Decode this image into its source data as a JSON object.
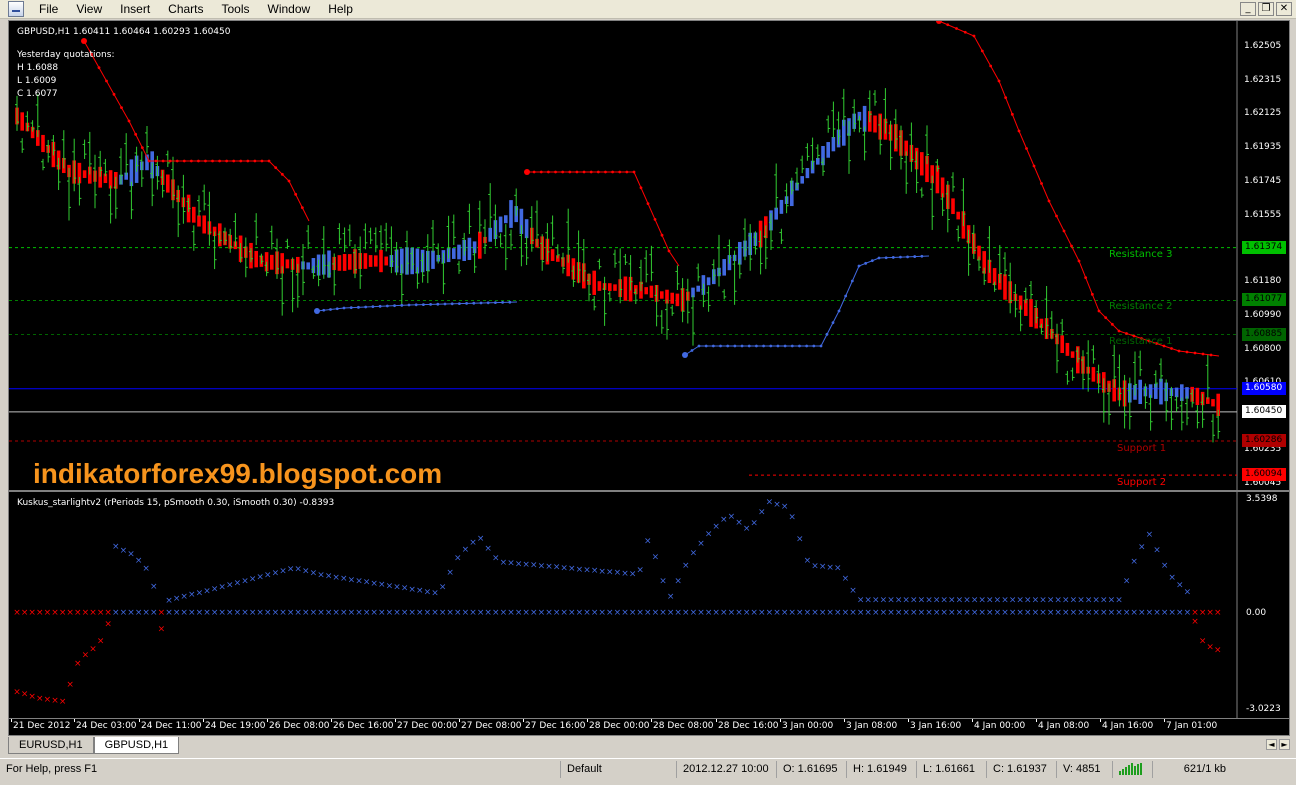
{
  "menu": [
    "File",
    "View",
    "Insert",
    "Charts",
    "Tools",
    "Window",
    "Help"
  ],
  "window_controls": [
    "_",
    "❐",
    "✕"
  ],
  "chart": {
    "title": "GBPUSD,H1  1.60411 1.60464 1.60293 1.60450",
    "quotes": {
      "heading": "Yesterday quotations:",
      "high": "H 1.6088",
      "low": "L 1.6009",
      "close": "C 1.6077"
    },
    "price_scale": [
      "1.62505",
      "1.62315",
      "1.62125",
      "1.61935",
      "1.61745",
      "1.61555",
      "1.61180",
      "1.60990",
      "1.60800",
      "1.60610",
      "1.60420",
      "1.60235",
      "1.60045"
    ],
    "price_scale_range": [
      1.60045,
      1.62505
    ],
    "highlighted_prices": [
      {
        "label": "1.61374",
        "bg": "#00c000",
        "fg": "#000000"
      },
      {
        "label": "1.61077",
        "bg": "#008000",
        "fg": "#000000"
      },
      {
        "label": "1.60885",
        "bg": "#006400",
        "fg": "#000000"
      },
      {
        "label": "1.60580",
        "bg": "#0000ff",
        "fg": "#ffffff"
      },
      {
        "label": "1.60450",
        "bg": "#ffffff",
        "fg": "#000000"
      },
      {
        "label": "1.60286",
        "bg": "#b00000",
        "fg": "#000000"
      },
      {
        "label": "1.60094",
        "bg": "#ff0000",
        "fg": "#000000"
      }
    ],
    "levels": [
      {
        "name": "Resistance 3",
        "price": 1.61374,
        "color": "#00c000"
      },
      {
        "name": "Resistance 2",
        "price": 1.61077,
        "color": "#008000"
      },
      {
        "name": "Resistance 1",
        "price": 1.60885,
        "color": "#006400"
      },
      {
        "name": "Support 1",
        "price": 1.60286,
        "color": "#b00000"
      },
      {
        "name": "Support 2",
        "price": 1.60094,
        "color": "#ff0000"
      }
    ],
    "bid_line_price": 1.6045,
    "blue_line_price": 1.6058,
    "watermark": "indikatorforex99.blogspot.com",
    "colors": {
      "candle_up": "#32cd32",
      "candle_down": "#32cd32",
      "heiken_up": "#4169e1",
      "heiken_down": "#ff0000",
      "stop_red": "#ff0000",
      "stop_blue": "#4169e1",
      "background": "#000000"
    }
  },
  "indicator": {
    "title": "Kuskus_starlightv2  (rPeriods 15, pSmooth 0.30, iSmooth 0.30)   -0.8393",
    "scale_top": "3.5398",
    "scale_zero": "0.00",
    "scale_bottom": "-3.0223",
    "range": [
      -3.0223,
      3.5398
    ],
    "colors": {
      "positive": "#4169e1",
      "negative": "#ff0000"
    }
  },
  "time_axis": [
    "21 Dec 2012",
    "24 Dec 03:00",
    "24 Dec 11:00",
    "24 Dec 19:00",
    "26 Dec 08:00",
    "26 Dec 16:00",
    "27 Dec 00:00",
    "27 Dec 08:00",
    "27 Dec 16:00",
    "28 Dec 00:00",
    "28 Dec 08:00",
    "28 Dec 16:00",
    "3 Jan 00:00",
    "3 Jan 08:00",
    "3 Jan 16:00",
    "4 Jan 00:00",
    "4 Jan 08:00",
    "4 Jan 16:00",
    "7 Jan 01:00"
  ],
  "tabs": [
    {
      "label": "EURUSD,H1",
      "active": false
    },
    {
      "label": "GBPUSD,H1",
      "active": true
    }
  ],
  "status": {
    "help": "For Help, press F1",
    "profile": "Default",
    "datetime": "2012.12.27 10:00",
    "open": "O: 1.61695",
    "high": "H: 1.61949",
    "low": "L: 1.61661",
    "close": "C: 1.61937",
    "volume": "V: 4851",
    "traffic": "621/1 kb"
  }
}
